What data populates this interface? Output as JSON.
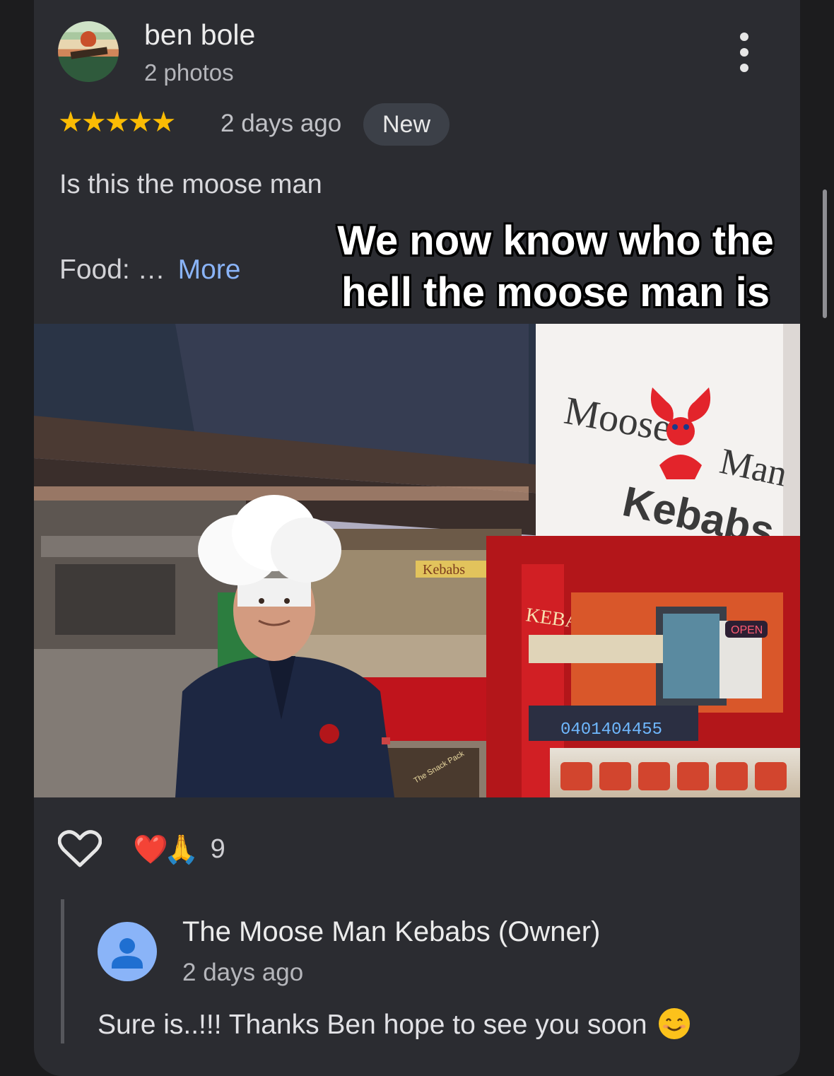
{
  "review": {
    "author": "ben bole",
    "author_photos": "2 photos",
    "rating": 5,
    "stars": "★★★★★",
    "date": "2 days ago",
    "badge": "New",
    "text": "Is this the moose man",
    "food_label": "Food: …",
    "more_link": "More",
    "caption_line1": "We now know who the",
    "caption_line2": "hell the moose man is",
    "menu_icon": "more-vert-icon"
  },
  "photo": {
    "sign_line1": "Moose",
    "sign_line2": "Man",
    "sign_line3": "Kebabs",
    "awning_sign": "Kebabs",
    "counter_sign": "KEBABS",
    "phone": "0401404455",
    "open_sign": "OPEN",
    "food_trailer_label": "The Snack Pack"
  },
  "reactions": {
    "like_icon": "heart-outline-icon",
    "emoji1": "❤️",
    "emoji2": "🙏",
    "count": "9"
  },
  "owner_reply": {
    "name": "The Moose Man Kebabs (Owner)",
    "date": "2 days ago",
    "text": "Sure is..!!! Thanks Ben hope to see you soon",
    "emoji": "smiling-face-icon"
  },
  "colors": {
    "card_bg": "#2b2c31",
    "star": "#fbbc04",
    "link": "#8ab4f8",
    "badge_bg": "#3c4048"
  }
}
